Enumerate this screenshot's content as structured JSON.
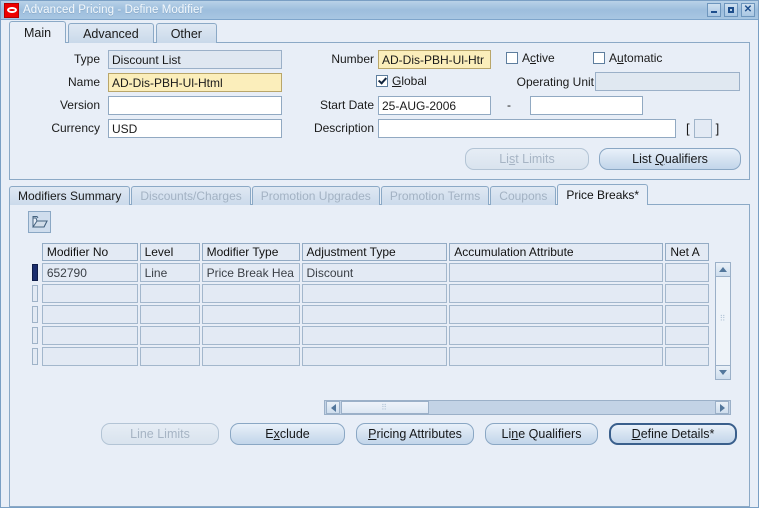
{
  "window": {
    "title": "Advanced Pricing - Define Modifier",
    "logo_icon": "oracle-logo",
    "buttons": {
      "minimize": "minimize-icon",
      "maximize": "maximize-icon",
      "close": "✕"
    }
  },
  "top_tabs": [
    {
      "label": "Main",
      "active": true
    },
    {
      "label": "Advanced",
      "active": false
    },
    {
      "label": "Other",
      "active": false
    }
  ],
  "header_form": {
    "type": {
      "label": "Type",
      "value": "Discount List"
    },
    "name": {
      "label": "Name",
      "value": "AD-Dis-PBH-Ul-Html"
    },
    "version": {
      "label": "Version",
      "value": ""
    },
    "currency": {
      "label": "Currency",
      "value": "USD"
    },
    "number": {
      "label": "Number",
      "value": "AD-Dis-PBH-Ul-Htr"
    },
    "active": {
      "label_pre": "A",
      "label_mn": "c",
      "label_post": "tive",
      "checked": false
    },
    "automatic": {
      "label_pre": "A",
      "label_mn": "u",
      "label_post": "tomatic",
      "checked": false
    },
    "global": {
      "label_mn": "G",
      "label_post": "lobal",
      "checked": true
    },
    "operating_unit": {
      "label": "Operating Unit",
      "value": ""
    },
    "start_date": {
      "label": "Start Date",
      "value": "25-AUG-2006"
    },
    "date_separator": "-",
    "end_date": {
      "value": ""
    },
    "description": {
      "label": "Description",
      "value": ""
    },
    "dff": {
      "open": "[",
      "close": "]"
    },
    "buttons": {
      "list_limits": {
        "pre": "Li",
        "mn": "s",
        "post": "t Limits",
        "disabled": true
      },
      "list_qualifiers": {
        "pre": "List ",
        "mn": "Q",
        "post": "ualifiers",
        "disabled": false
      }
    }
  },
  "lower_tabs": [
    {
      "label": "Modifiers Summary",
      "state": "enabled"
    },
    {
      "label": "Discounts/Charges",
      "state": "dim"
    },
    {
      "label": "Promotion Upgrades",
      "state": "dim"
    },
    {
      "label": "Promotion Terms",
      "state": "dim"
    },
    {
      "label": "Coupons",
      "state": "dim"
    },
    {
      "label": "Price Breaks*",
      "state": "active"
    }
  ],
  "price_breaks": {
    "folder_icon": "open-folder-icon",
    "columns": [
      "Modifier No",
      "Level",
      "Modifier Type",
      "Adjustment Type",
      "Accumulation Attribute",
      "Net A"
    ],
    "rows": [
      {
        "selected": true,
        "cells": [
          "652790",
          "Line",
          "Price Break Hea",
          "Discount",
          "",
          ""
        ]
      },
      {
        "selected": false,
        "cells": [
          "",
          "",
          "",
          "",
          "",
          ""
        ]
      },
      {
        "selected": false,
        "cells": [
          "",
          "",
          "",
          "",
          "",
          ""
        ]
      },
      {
        "selected": false,
        "cells": [
          "",
          "",
          "",
          "",
          "",
          ""
        ]
      },
      {
        "selected": false,
        "cells": [
          "",
          "",
          "",
          "",
          "",
          ""
        ]
      }
    ]
  },
  "bottom_buttons": [
    {
      "pre": "Line Limits",
      "mn": "",
      "post": "",
      "disabled": true,
      "focused": false
    },
    {
      "pre": "E",
      "mn": "x",
      "post": "clude",
      "disabled": false,
      "focused": false
    },
    {
      "pre": "",
      "mn": "P",
      "post": "ricing Attributes",
      "disabled": false,
      "focused": false
    },
    {
      "pre": "Li",
      "mn": "n",
      "post": "e Qualifiers",
      "disabled": false,
      "focused": false
    },
    {
      "pre": "",
      "mn": "D",
      "post": "efine Details*",
      "disabled": false,
      "focused": true
    }
  ]
}
